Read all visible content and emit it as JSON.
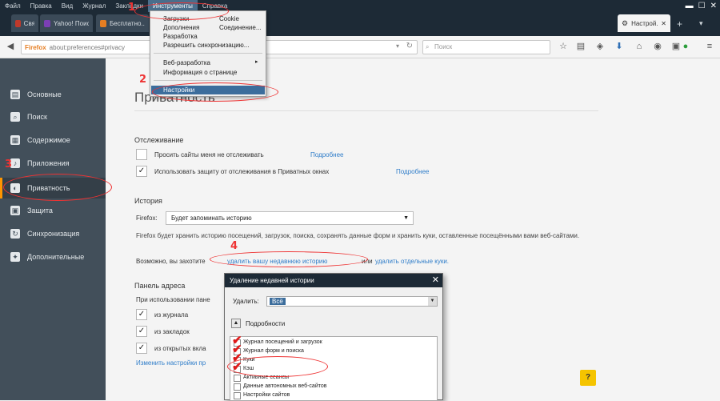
{
  "menubar": {
    "items": [
      "Файл",
      "Правка",
      "Вид",
      "Журнал",
      "Закладки",
      "Инструменты",
      "Справка"
    ],
    "active_index": 5
  },
  "tabs": [
    {
      "label": "Свяжитесь с...",
      "active": false
    },
    {
      "label": "Yahoo! Поиск...",
      "active": false
    },
    {
      "label": "Бесплатно...",
      "active": false
    },
    {
      "label": "Настрой...",
      "active": true
    }
  ],
  "toolbar": {
    "url_badge": "Firefox",
    "url": "about:preferences#privacy",
    "search_placeholder": "Поиск"
  },
  "tools_menu": {
    "items_col1": [
      "Загрузки",
      "Дополнения",
      "Разработка",
      "Разрешить синхронизацию..."
    ],
    "items_col2": [
      "Cookie",
      "Соединение..."
    ],
    "dev_item": "Веб-разработка",
    "page_info": "Информация о странице",
    "settings": "Настройки"
  },
  "sidebar": {
    "items": [
      {
        "label": "Основные",
        "icon": "page-icon"
      },
      {
        "label": "Поиск",
        "icon": "search-icon"
      },
      {
        "label": "Содержимое",
        "icon": "content-icon"
      },
      {
        "label": "Приложения",
        "icon": "bell-icon"
      },
      {
        "label": "Приватность",
        "icon": "mask-icon"
      },
      {
        "label": "Защита",
        "icon": "lock-icon"
      },
      {
        "label": "Синхронизация",
        "icon": "sync-icon"
      },
      {
        "label": "Дополнительные",
        "icon": "wizard-icon"
      }
    ],
    "selected_index": 4
  },
  "main": {
    "page_title": "Приватность",
    "tracking": {
      "heading": "Отслеживание",
      "option1": "Просить сайты меня не отслеживать",
      "option1_checked": false,
      "option1_link": "Подробнее",
      "option2": "Использовать защиту от отслеживания в Приватных окнах",
      "option2_checked": true,
      "option2_link": "Подробнее"
    },
    "history": {
      "heading": "История",
      "firefox_label": "Firefox:",
      "select_value": "Будет запоминать историю",
      "desc": "Firefox будет хранить историю посещений, загрузок, поиска, сохранять данные форм и хранить куки, оставленные посещёнными вами веб-сайтами.",
      "maybe": "Возможно, вы захотите",
      "link_clear": "удалить вашу недавнюю историю",
      "or": "или",
      "link_cookies": "удалить отдельные куки."
    },
    "address_bar": {
      "heading": "Панель адреса",
      "when_using": "При использовании пане",
      "opt1": "из журнала",
      "opt2": "из закладок",
      "opt3": "из открытых вкла",
      "link_change": "Изменить настройки пр"
    }
  },
  "dialog": {
    "title": "Удаление недавней истории",
    "range_label": "Удалить:",
    "range_value": "Всё",
    "details_label": "Подробности",
    "items": [
      {
        "label": "Журнал посещений и загрузок",
        "checked": true
      },
      {
        "label": "Журнал форм и поиска",
        "checked": true
      },
      {
        "label": "Куки",
        "checked": true
      },
      {
        "label": "Кэш",
        "checked": true
      },
      {
        "label": "Активные сеансы",
        "checked": false
      },
      {
        "label": "Данные автономных веб-сайтов",
        "checked": false
      },
      {
        "label": "Настройки сайтов",
        "checked": false
      }
    ]
  },
  "annotations": [
    "1",
    "2",
    "3",
    "4"
  ],
  "colors": {
    "accent_red": "#e33333",
    "sidebar_bg": "#424f5a",
    "link_blue": "#2f7dc9",
    "menu_highlight": "#3c6d9c"
  }
}
